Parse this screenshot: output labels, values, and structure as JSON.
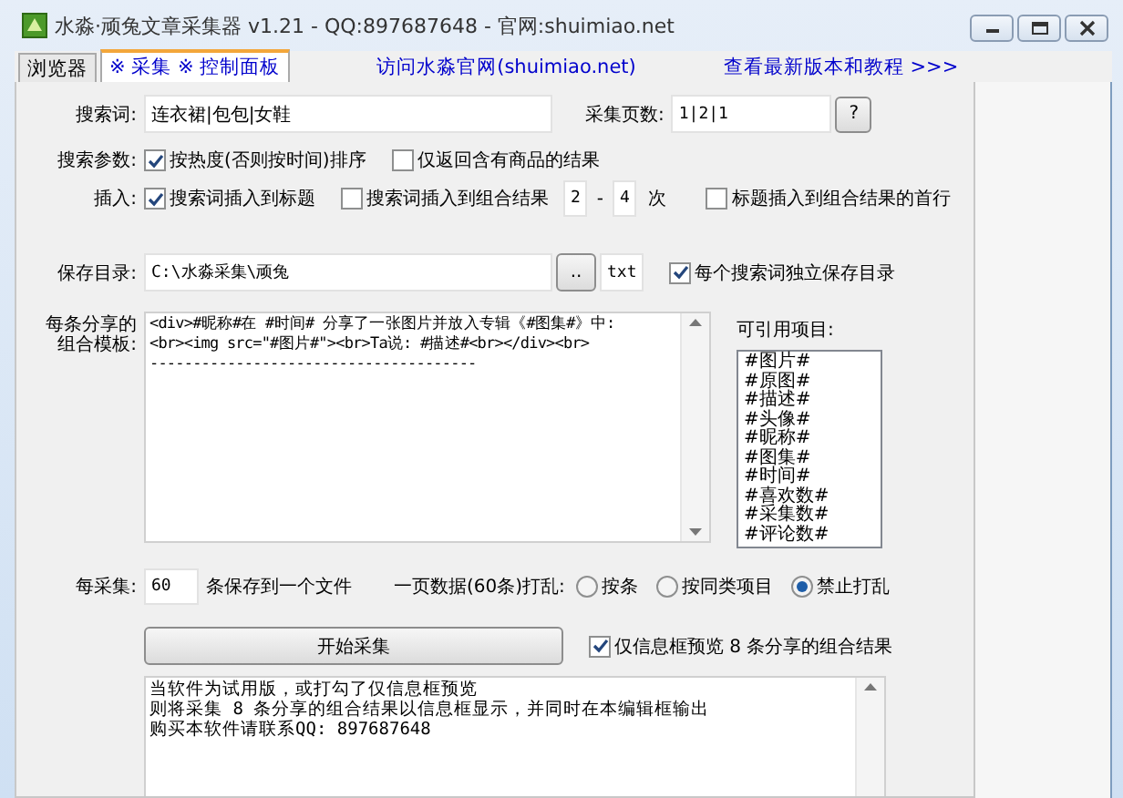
{
  "window": {
    "title": "水淼·顽兔文章采集器 v1.21 - QQ:897687648 - 官网:shuimiao.net"
  },
  "tabs": [
    {
      "label": "浏览器",
      "selected": false
    },
    {
      "label": "※ 采集 ※ 控制面板",
      "selected": true
    }
  ],
  "links": [
    "访问水淼官网(shuimiao.net)",
    "查看最新版本和教程 >>>"
  ],
  "search": {
    "label": "搜索词:",
    "value": "连衣裙|包包|女鞋",
    "pages_label": "采集页数:",
    "pages_value": "1|2|1",
    "help_button": "?"
  },
  "params": {
    "label": "搜索参数:",
    "options": [
      {
        "label": "按热度(否则按时间)排序",
        "checked": true
      },
      {
        "label": "仅返回含有商品的结果",
        "checked": false
      }
    ]
  },
  "insert": {
    "label": "插入:",
    "options": [
      {
        "label": "搜索词插入到标题",
        "checked": true
      },
      {
        "label": "搜索词插入到组合结果",
        "checked": false
      }
    ],
    "min": "2",
    "dash": "-",
    "max": "4",
    "unit": "次",
    "first_line": {
      "label": "标题插入到组合结果的首行",
      "checked": false
    }
  },
  "save": {
    "label": "保存目录:",
    "value": "C:\\水淼采集\\顽兔",
    "browse_button": "..",
    "extension": "txt",
    "per_keyword": {
      "label": "每个搜索词独立保存目录",
      "checked": true
    }
  },
  "template": {
    "label_lines": [
      "每条分享的",
      "组合模板:"
    ],
    "value": "<div>#昵称#在 #时间# 分享了一张图片并放入专辑《#图集#》中:\n<br><img src=\"#图片#\"><br>Ta说: #描述#<br></div><br>\n--------------------------------------",
    "fields_label": "可引用项目:",
    "fields": [
      "#图片#",
      "#原图#",
      "#描述#",
      "#头像#",
      "#昵称#",
      "#图集#",
      "#时间#",
      "#喜欢数#",
      "#采集数#",
      "#评论数#"
    ]
  },
  "batch": {
    "label": "每采集:",
    "value": "60",
    "suffix": "条保存到一个文件",
    "shuffle_label": "一页数据(60条)打乱:",
    "shuffle_options": [
      {
        "label": "按条",
        "selected": false
      },
      {
        "label": "按同类项目",
        "selected": false
      },
      {
        "label": "禁止打乱",
        "selected": true
      }
    ]
  },
  "start_button": "开始采集",
  "preview": {
    "label": "仅信息框预览 8 条分享的组合结果",
    "checked": true
  },
  "log": [
    "当软件为试用版，或打勾了仅信息框预览",
    "则将采集 8 条分享的组合结果以信息框显示，并同时在本编辑框输出",
    "购买本软件请联系QQ: 897687648"
  ]
}
